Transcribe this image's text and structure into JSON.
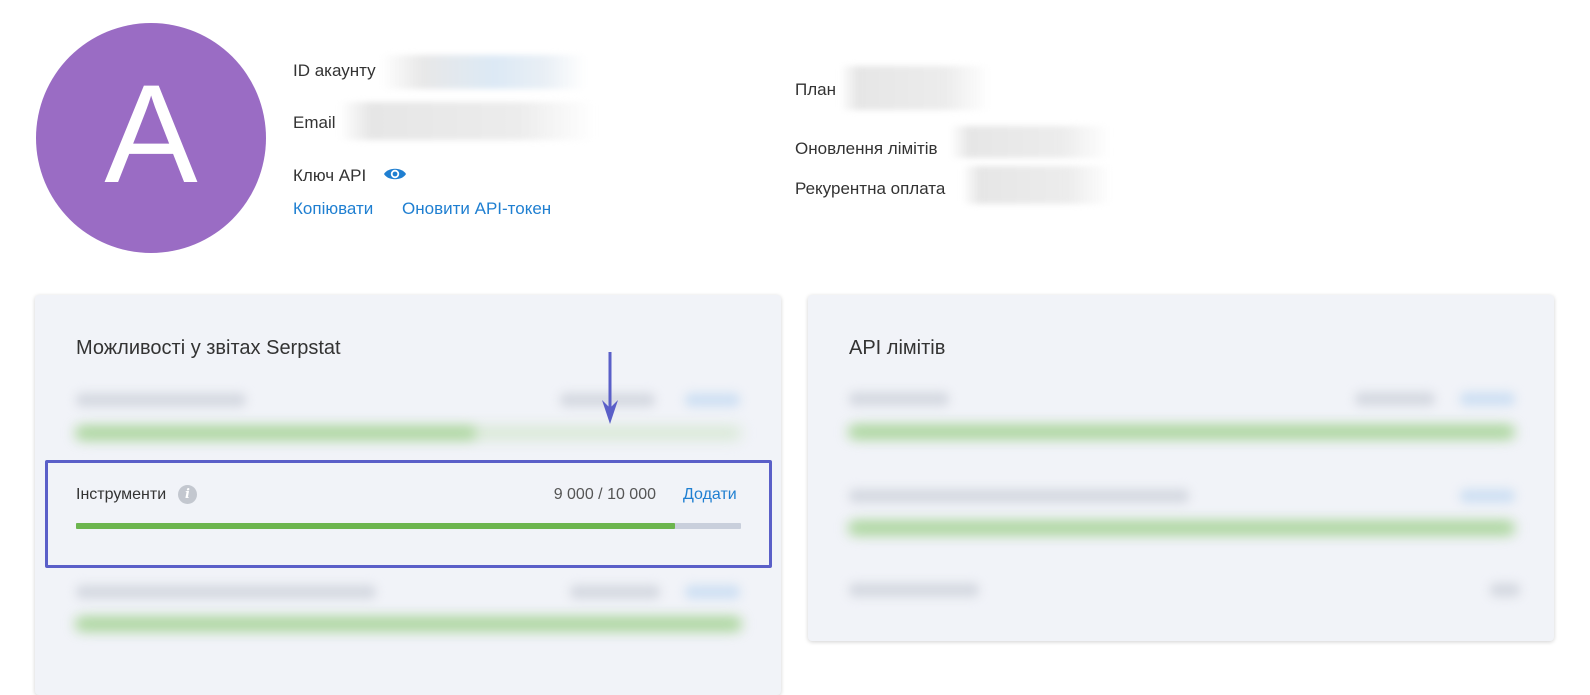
{
  "profile": {
    "avatar_letter": "A",
    "account_id_label": "ID акаунту",
    "email_label": "Email",
    "api_key_label": "Ключ API",
    "copy_link": "Копіювати",
    "refresh_token_link": "Оновити API-токен",
    "plan_label": "План",
    "limits_update_label": "Оновлення лімітів",
    "recurring_payment_label": "Рекурентна оплата"
  },
  "reports_card": {
    "title": "Можливості у звітах Serpstat",
    "tools_row": {
      "label": "Інструменти",
      "info_icon": "i",
      "count": "9 000 / 10 000",
      "used": 9000,
      "total": 10000,
      "add_link": "Додати"
    }
  },
  "api_card": {
    "title": "API лімітів"
  },
  "colors": {
    "avatar": "#9a6cc4",
    "link": "#1f7fd1",
    "progress_fill": "#6cb54e",
    "progress_track": "#c9cfdc",
    "highlight_border": "#5a5fc8",
    "card_bg": "#f1f3f8"
  },
  "icons": {
    "api_key_toggle": "eye-icon",
    "tools_info": "info-icon",
    "annotation": "arrow-down-icon"
  }
}
